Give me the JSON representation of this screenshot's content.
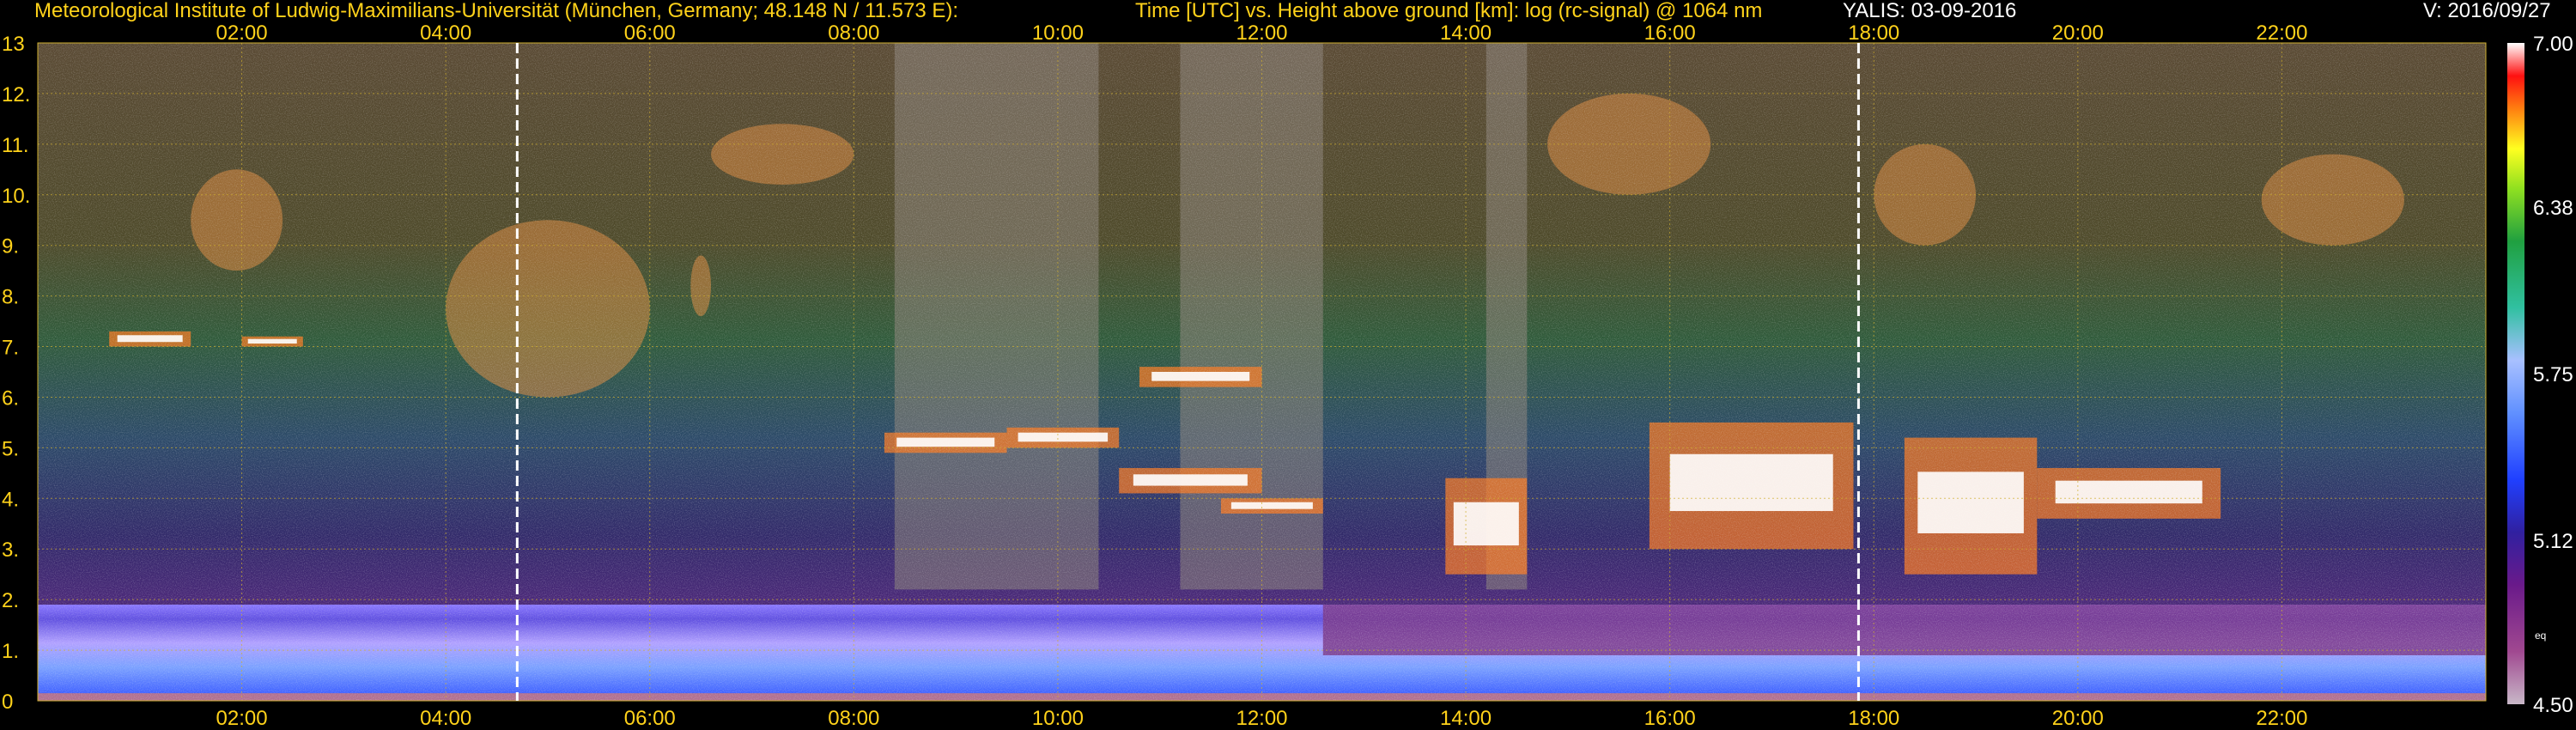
{
  "header": {
    "institute": "Meteorological Institute of Ludwig-Maximilians-Universität (München, Germany; 48.148 N / 11.573 E):",
    "plot_title": "Time [UTC] vs. Height above ground [km]: log (rc-signal) @ 1064 nm",
    "station_date": "YALIS: 03-09-2016",
    "version": "V: 2016/09/27"
  },
  "chart_data": {
    "type": "heatmap",
    "title": "Time [UTC] vs. Height above ground [km]: log (rc-signal) @ 1064 nm",
    "x_axis": {
      "label": "Time [UTC]",
      "range_hours": [
        0,
        24
      ],
      "tick_labels": [
        "02:00",
        "04:00",
        "06:00",
        "08:00",
        "10:00",
        "12:00",
        "14:00",
        "16:00",
        "18:00",
        "20:00",
        "22:00"
      ],
      "tick_hours": [
        2,
        4,
        6,
        8,
        10,
        12,
        14,
        16,
        18,
        20,
        22
      ]
    },
    "y_axis": {
      "label": "Height above ground [km]",
      "range_km": [
        0,
        13
      ],
      "tick_labels": [
        "0",
        "1.",
        "2.",
        "3.",
        "4.",
        "5.",
        "6.",
        "7.",
        "8.",
        "9.",
        "10.",
        "11.",
        "12.",
        "13"
      ],
      "tick_values": [
        0,
        1,
        2,
        3,
        4,
        5,
        6,
        7,
        8,
        9,
        10,
        11,
        12,
        13
      ]
    },
    "grid": true,
    "colorbar": {
      "range": [
        4.5,
        7.0
      ],
      "tick_labels": [
        "7.00",
        "6.38",
        "5.75",
        "5.12",
        "4.50"
      ],
      "tick_values": [
        7.0,
        6.38,
        5.75,
        5.12,
        4.5
      ],
      "note": "eq"
    },
    "markers_utc_hours": [
      4.7,
      17.85
    ],
    "boundary_layer_top_km": 1.9,
    "clouds": [
      {
        "t": [
          0.7,
          1.5
        ],
        "h": [
          7.0,
          7.3
        ]
      },
      {
        "t": [
          2.0,
          2.6
        ],
        "h": [
          7.0,
          7.2
        ]
      },
      {
        "t": [
          8.3,
          9.5
        ],
        "h": [
          4.9,
          5.3
        ]
      },
      {
        "t": [
          9.5,
          10.6
        ],
        "h": [
          5.0,
          5.4
        ]
      },
      {
        "t": [
          10.6,
          12.0
        ],
        "h": [
          4.1,
          4.6
        ]
      },
      {
        "t": [
          11.6,
          12.6
        ],
        "h": [
          3.7,
          4.0
        ]
      },
      {
        "t": [
          10.8,
          12.0
        ],
        "h": [
          6.2,
          6.6
        ]
      },
      {
        "t": [
          13.8,
          14.6
        ],
        "h": [
          2.5,
          4.4
        ]
      },
      {
        "t": [
          15.8,
          17.8
        ],
        "h": [
          3.0,
          5.5
        ]
      },
      {
        "t": [
          18.3,
          19.6
        ],
        "h": [
          2.5,
          5.2
        ]
      },
      {
        "t": [
          19.6,
          21.4
        ],
        "h": [
          3.6,
          4.6
        ]
      }
    ],
    "aerosol_layers": [
      {
        "t": [
          1.5,
          2.4
        ],
        "h": [
          8.5,
          10.5
        ]
      },
      {
        "t": [
          4.0,
          6.0
        ],
        "h": [
          6.0,
          9.5
        ]
      },
      {
        "t": [
          6.4,
          6.6
        ],
        "h": [
          7.6,
          8.8
        ]
      },
      {
        "t": [
          6.6,
          8.0
        ],
        "h": [
          10.2,
          11.4
        ]
      },
      {
        "t": [
          14.8,
          16.4
        ],
        "h": [
          10.0,
          12.0
        ]
      },
      {
        "t": [
          18.0,
          19.0
        ],
        "h": [
          9.0,
          11.0
        ]
      },
      {
        "t": [
          21.8,
          23.2
        ],
        "h": [
          9.0,
          10.8
        ]
      }
    ],
    "noisy_bands_utc_hours": [
      [
        8.4,
        10.4
      ],
      [
        11.2,
        12.6
      ],
      [
        14.2,
        14.6
      ]
    ]
  }
}
